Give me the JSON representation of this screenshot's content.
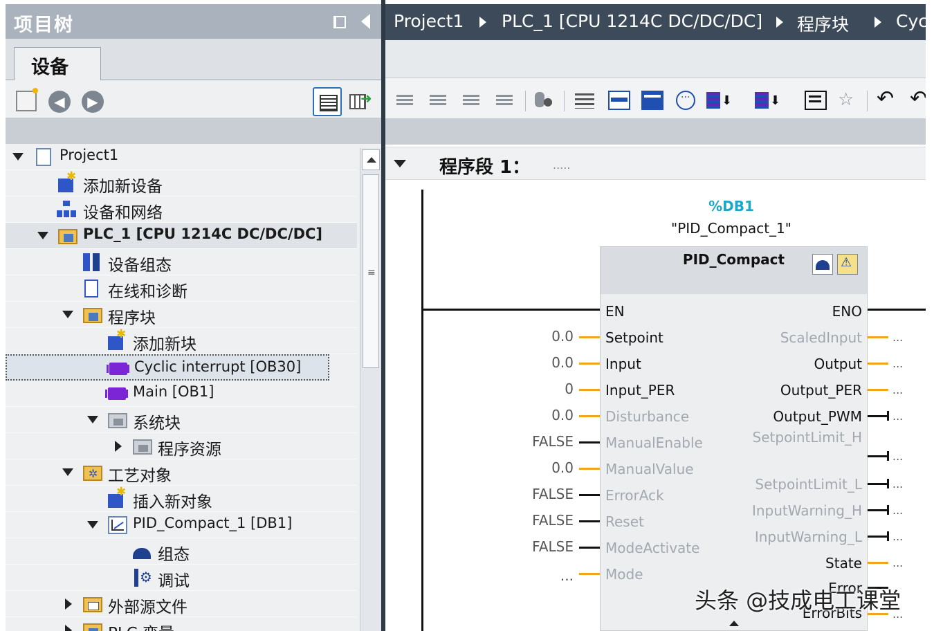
{
  "project_tree": {
    "title": "项目树",
    "tab": "设备",
    "items": [
      {
        "label": "Project1"
      },
      {
        "label": "添加新设备"
      },
      {
        "label": "设备和网络"
      },
      {
        "label": "PLC_1 [CPU 1214C DC/DC/DC]"
      },
      {
        "label": "设备组态"
      },
      {
        "label": "在线和诊断"
      },
      {
        "label": "程序块"
      },
      {
        "label": "添加新块"
      },
      {
        "label": "Cyclic interrupt [OB30]"
      },
      {
        "label": "Main [OB1]"
      },
      {
        "label": "系统块"
      },
      {
        "label": "程序资源"
      },
      {
        "label": "工艺对象"
      },
      {
        "label": "插入新对象"
      },
      {
        "label": "PID_Compact_1 [DB1]"
      },
      {
        "label": "组态"
      },
      {
        "label": "调试"
      },
      {
        "label": "外部源文件"
      },
      {
        "label": "PLC 变量"
      }
    ]
  },
  "breadcrumb": [
    "Project1",
    "PLC_1 [CPU 1214C DC/DC/DC]",
    "程序块",
    "Cyc"
  ],
  "network": {
    "title": "程序段 1：",
    "comment": "....."
  },
  "block": {
    "db": "%DB1",
    "instance": "\"PID_Compact_1\"",
    "type": "PID_Compact",
    "inputs": [
      {
        "name": "EN",
        "value": ""
      },
      {
        "name": "Setpoint",
        "value": "0.0"
      },
      {
        "name": "Input",
        "value": "0.0"
      },
      {
        "name": "Input_PER",
        "value": "0"
      },
      {
        "name": "Disturbance",
        "value": "0.0"
      },
      {
        "name": "ManualEnable",
        "value": "FALSE"
      },
      {
        "name": "ManualValue",
        "value": "0.0"
      },
      {
        "name": "ErrorAck",
        "value": "FALSE"
      },
      {
        "name": "Reset",
        "value": "FALSE"
      },
      {
        "name": "ModeActivate",
        "value": "FALSE"
      },
      {
        "name": "Mode",
        "value": "..."
      }
    ],
    "outputs": [
      {
        "name": "ENO"
      },
      {
        "name": "ScaledInput"
      },
      {
        "name": "Output"
      },
      {
        "name": "Output_PER"
      },
      {
        "name": "Output_PWM"
      },
      {
        "name": "SetpointLimit_H"
      },
      {
        "name": "SetpointLimit_L"
      },
      {
        "name": "InputWarning_H"
      },
      {
        "name": "InputWarning_L"
      },
      {
        "name": "State"
      },
      {
        "name": "Error"
      },
      {
        "name": "ErrorBits"
      }
    ],
    "unconnected_output": "..."
  },
  "watermark": "头条 @技成电工课堂",
  "colors": {
    "accent_blue": "#1f4fb0",
    "db_teal": "#1ca6c8",
    "real_wire": "#f2a41b",
    "breadcrumb_bg": "#3d4a59",
    "panel_title_bg": "#a9b2bd"
  }
}
